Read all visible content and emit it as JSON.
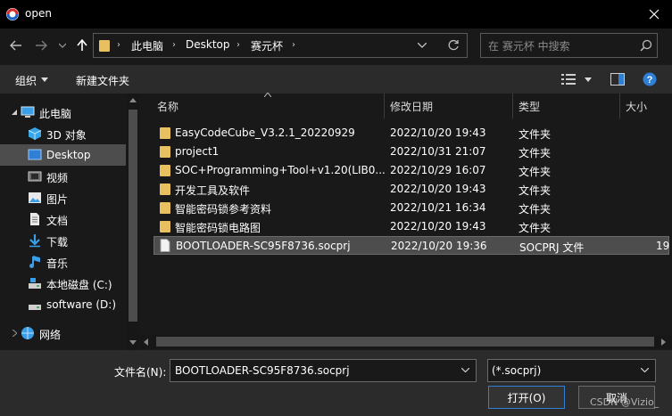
{
  "window": {
    "title": "open"
  },
  "address": {
    "crumbs": [
      "此电脑",
      "Desktop",
      "赛元杯"
    ]
  },
  "search": {
    "placeholder": "在 赛元杯 中搜索"
  },
  "toolbar": {
    "organize": "组织",
    "new_folder": "新建文件夹"
  },
  "nav": {
    "items": [
      {
        "label": "此电脑",
        "icon": "computer-icon"
      },
      {
        "label": "3D 对象",
        "icon": "3d-objects-icon"
      },
      {
        "label": "Desktop",
        "icon": "desktop-icon"
      },
      {
        "label": "视频",
        "icon": "video-icon"
      },
      {
        "label": "图片",
        "icon": "pictures-icon"
      },
      {
        "label": "文档",
        "icon": "documents-icon"
      },
      {
        "label": "下载",
        "icon": "downloads-icon"
      },
      {
        "label": "音乐",
        "icon": "music-icon"
      },
      {
        "label": "本地磁盘 (C:)",
        "icon": "drive-icon"
      },
      {
        "label": "software (D:)",
        "icon": "drive-icon"
      },
      {
        "label": "网络",
        "icon": "network-icon"
      }
    ]
  },
  "columns": {
    "name": "名称",
    "date": "修改日期",
    "type": "类型",
    "size": "大小"
  },
  "files": [
    {
      "name": "EasyCodeCube_V3.2.1_20220929",
      "date": "2022/10/20 19:43",
      "type": "文件夹",
      "size": ""
    },
    {
      "name": "project1",
      "date": "2022/10/31 21:07",
      "type": "文件夹",
      "size": ""
    },
    {
      "name": "SOC+Programming+Tool+v1.20(LIB0...",
      "date": "2022/10/29 16:07",
      "type": "文件夹",
      "size": ""
    },
    {
      "name": "开发工具及软件",
      "date": "2022/10/20 19:43",
      "type": "文件夹",
      "size": ""
    },
    {
      "name": "智能密码锁参考资料",
      "date": "2022/10/21 16:34",
      "type": "文件夹",
      "size": ""
    },
    {
      "name": "智能密码锁电路图",
      "date": "2022/10/20 19:43",
      "type": "文件夹",
      "size": ""
    },
    {
      "name": "BOOTLOADER-SC95F8736.socprj",
      "date": "2022/10/20 19:36",
      "type": "SOCPRJ 文件",
      "size": "19"
    }
  ],
  "bottom": {
    "filename_label": "文件名(N):",
    "filename_value": "BOOTLOADER-SC95F8736.socprj",
    "filter_value": "(*.socprj)",
    "open_label": "打开(O)",
    "cancel_label": "取消"
  },
  "watermark": "CSDN @Vizio_",
  "colors": {
    "folder": "#e8c060",
    "selected_row": "#4d4d4d",
    "accent": "#2f7fd6"
  }
}
